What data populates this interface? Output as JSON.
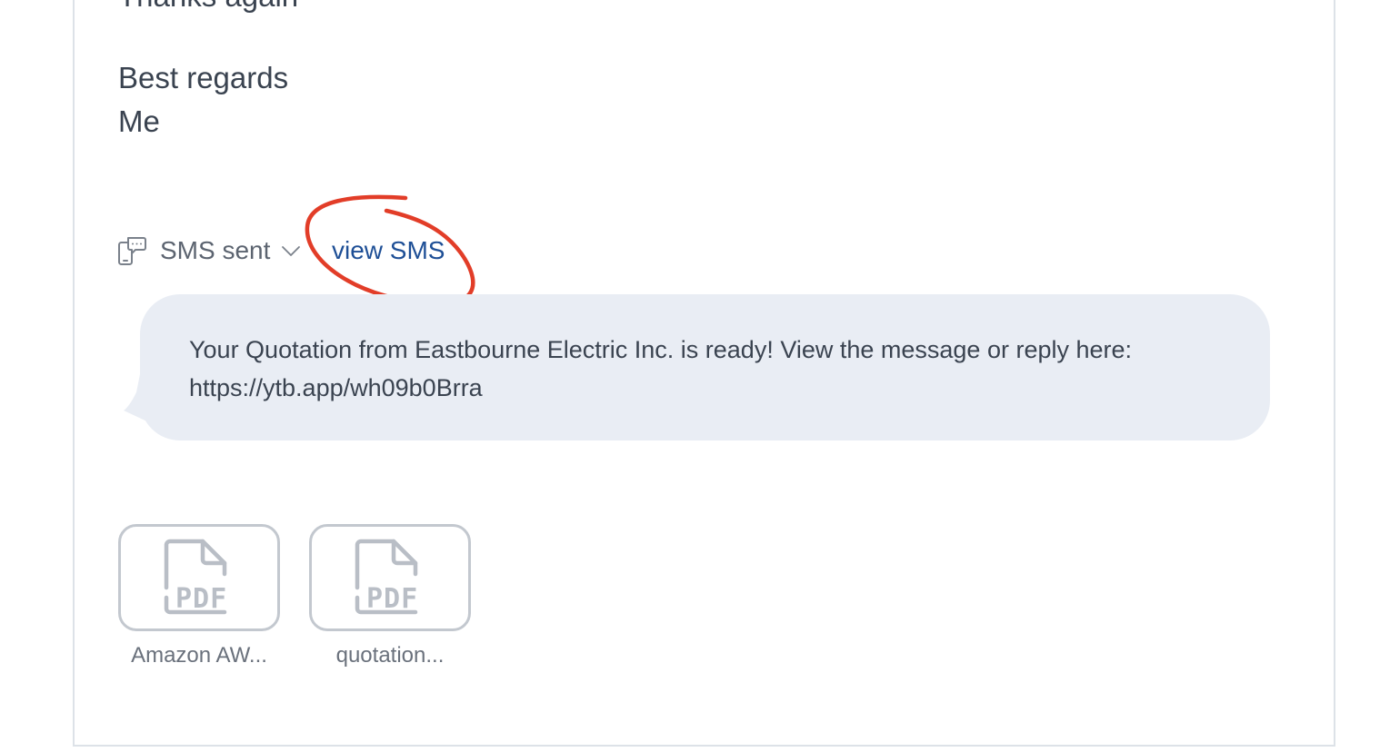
{
  "email": {
    "closing_lines": [
      "Thanks again",
      "Best regards",
      "Me"
    ]
  },
  "sms": {
    "status_label": "SMS sent",
    "view_link_label": "view SMS",
    "message": "Your Quotation from Eastbourne Electric Inc. is ready! View the message or reply here: https://ytb.app/wh09b0Brra"
  },
  "attachments": [
    {
      "name": "Amazon AW...",
      "type_label": "PDF"
    },
    {
      "name": "quotation...",
      "type_label": "PDF"
    }
  ],
  "colors": {
    "link": "#1e4f96",
    "annotation": "#e23d28",
    "bubble_background": "#e9edf4",
    "attachment_border": "#c3c8cf"
  },
  "icons": {
    "sms": "phone-chat-icon",
    "status_toggle": "chevron-down-icon",
    "attachment": "pdf-file-icon"
  }
}
